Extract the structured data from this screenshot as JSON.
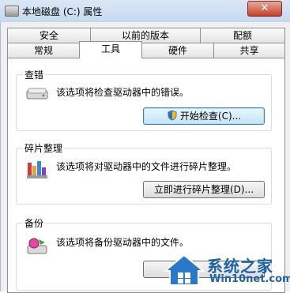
{
  "window": {
    "title": "本地磁盘 (C:) 属性",
    "close_glyph": "✕"
  },
  "tabs": {
    "row1": [
      "安全",
      "以前的版本",
      "配额"
    ],
    "row2": [
      "常规",
      "工具",
      "硬件",
      "共享"
    ],
    "active": "工具"
  },
  "sections": {
    "check": {
      "label": "查错",
      "description": "该选项将检查驱动器中的错误。",
      "button": "开始检查(C)..."
    },
    "defrag": {
      "label": "碎片整理",
      "description": "该选项将对驱动器中的文件进行碎片整理。",
      "button": "立即进行碎片整理(D)..."
    },
    "backup": {
      "label": "备份",
      "description": "该选项将备份驱动器中的文件。",
      "button": ""
    }
  },
  "watermark": {
    "brand": "系统之家",
    "site": "Win10net.com"
  },
  "colors": {
    "accent": "#1e63a8",
    "titlebar": "#c6d8ef",
    "close": "#c5402a"
  }
}
